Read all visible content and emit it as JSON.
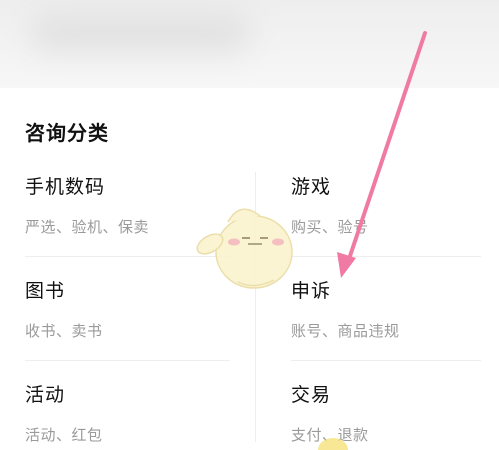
{
  "section": {
    "title": "咨询分类"
  },
  "categories": [
    {
      "name": "手机数码",
      "desc": "严选、验机、保卖"
    },
    {
      "name": "游戏",
      "desc": "购买、验号"
    },
    {
      "name": "图书",
      "desc": "收书、卖书"
    },
    {
      "name": "申诉",
      "desc": "账号、商品违规"
    },
    {
      "name": "活动",
      "desc": "活动、红包"
    },
    {
      "name": "交易",
      "desc": "支付、退款"
    }
  ],
  "colors": {
    "annotation_arrow": "#f07aa3",
    "title_text": "#111111",
    "secondary_text": "#9a9a9a"
  }
}
